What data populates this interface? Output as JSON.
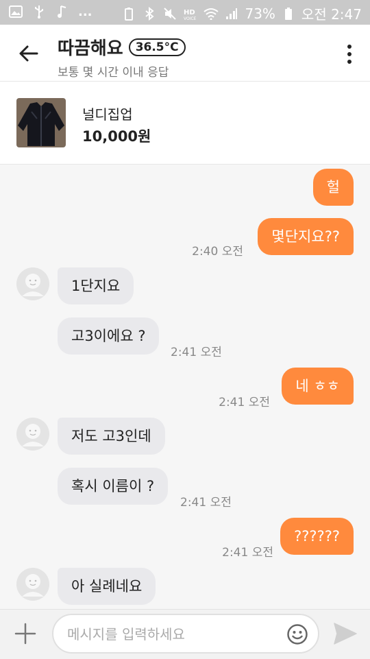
{
  "status_bar": {
    "battery": "73%",
    "time": "오전 2:47",
    "icons_left": [
      "image-icon",
      "usb-icon",
      "music-icon",
      "more-icon"
    ],
    "icons_right": [
      "battery-saver-icon",
      "bluetooth-icon",
      "mute-icon",
      "hd-voice-icon",
      "wifi-icon",
      "signal-icon",
      "battery-icon"
    ],
    "more": "..."
  },
  "header": {
    "title": "따끔해요",
    "temperature": "36.5°C",
    "subtitle": "보통 몇 시간 이내 응답"
  },
  "product": {
    "name": "널디집업",
    "price": "10,000원"
  },
  "messages": [
    {
      "side": "out",
      "text": "헐",
      "time": ""
    },
    {
      "side": "out",
      "text": "몇단지요??",
      "time": "2:40 오전"
    },
    {
      "side": "in",
      "text": "1단지요",
      "time": ""
    },
    {
      "side": "in",
      "text": "고3이에요 ?",
      "time": "2:41 오전"
    },
    {
      "side": "out",
      "text": "네 ㅎㅎ",
      "time": "2:41 오전"
    },
    {
      "side": "in",
      "text": "저도 고3인데",
      "time": ""
    },
    {
      "side": "in",
      "text": "혹시 이름이 ?",
      "time": "2:41 오전"
    },
    {
      "side": "out",
      "text": "??????",
      "time": "2:41 오전"
    },
    {
      "side": "in",
      "text": "아 실례네요",
      "time": ""
    }
  ],
  "input": {
    "placeholder": "메시지를 입력하세요",
    "value": ""
  },
  "colors": {
    "accent": "#ff8a3d",
    "incoming_bubble": "#e9e9ec",
    "status_bar": "#c9c9c9"
  }
}
